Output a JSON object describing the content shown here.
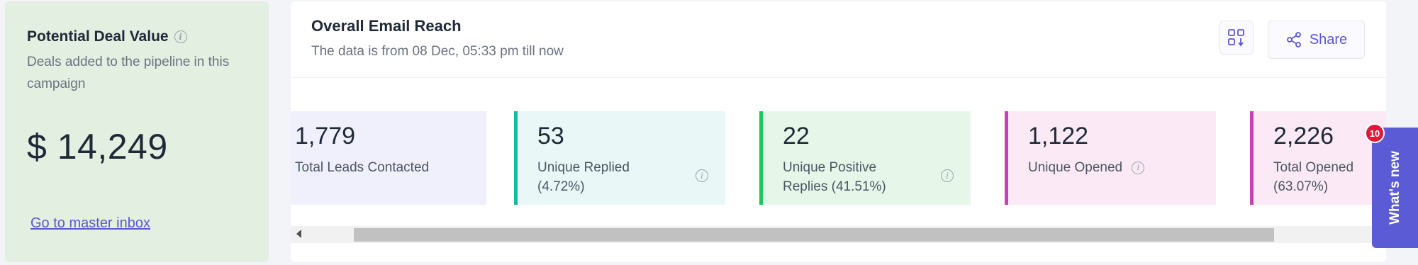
{
  "deal": {
    "title": "Potential Deal Value",
    "subtitle": "Deals added to the pipeline in this campaign",
    "value": "$ 14,249",
    "link": "Go to master inbox"
  },
  "panel": {
    "title": "Overall Email Reach",
    "subtitle": "The data is from 08 Dec, 05:33 pm till now",
    "share_label": "Share"
  },
  "stats": [
    {
      "value": "1,779",
      "label": "Total Leads Contacted",
      "accent": ""
    },
    {
      "value": "53",
      "label": "Unique Replied (4.72%)",
      "accent": "#14b8a6"
    },
    {
      "value": "22",
      "label": "Unique Positive Replies (41.51%)",
      "accent": "#22c55e"
    },
    {
      "value": "1,122",
      "label": "Unique Opened",
      "accent": "#c044b4"
    },
    {
      "value": "2,226",
      "label": "Total Opened (63.07%)",
      "accent": "#c044b4"
    }
  ],
  "whats_new": {
    "label": "What's new",
    "badge": "10",
    "color": "#5b5bd6"
  },
  "colors": {
    "deal_bg": "#e3efe0",
    "link": "#5b57d1"
  }
}
